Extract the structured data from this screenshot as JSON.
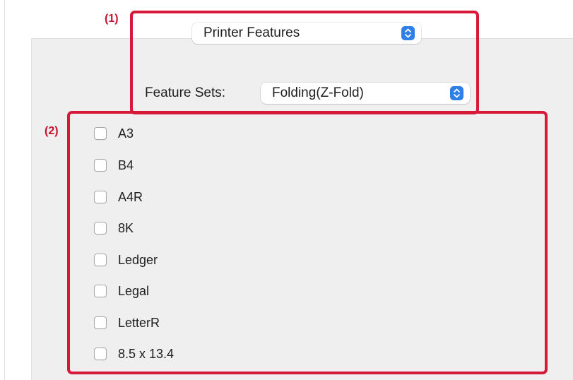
{
  "callouts": {
    "one": "(1)",
    "two": "(2)"
  },
  "printer_popup": {
    "value": "Printer Features",
    "icon": "up-down-chevron-icon"
  },
  "feature_sets": {
    "label": "Feature Sets:",
    "value": "Folding(Z-Fold)",
    "icon": "up-down-chevron-icon"
  },
  "paper_options": [
    {
      "label": "A3",
      "checked": false
    },
    {
      "label": "B4",
      "checked": false
    },
    {
      "label": "A4R",
      "checked": false
    },
    {
      "label": "8K",
      "checked": false
    },
    {
      "label": "Ledger",
      "checked": false
    },
    {
      "label": "Legal",
      "checked": false
    },
    {
      "label": "LetterR",
      "checked": false
    },
    {
      "label": "8.5 x 13.4",
      "checked": false
    }
  ],
  "colors": {
    "callout_red": "#d6193a",
    "accent_blue": "#2f7fe8",
    "panel_bg": "#efefef"
  }
}
